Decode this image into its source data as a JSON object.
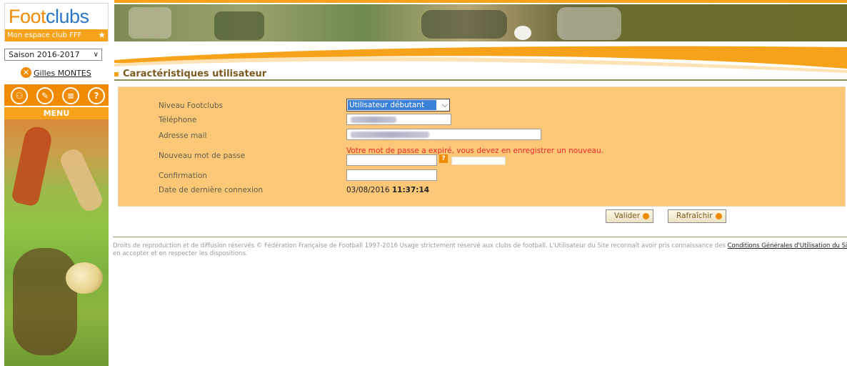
{
  "logo": {
    "part1": "Foot",
    "part2": "clubs",
    "tagline": "Mon espace club FFF"
  },
  "season_select": {
    "value": "Saison 2016-2017"
  },
  "user": {
    "name": "Gilles MONTES"
  },
  "menu": {
    "label": "MENU"
  },
  "section": {
    "title": "Caractéristiques utilisateur"
  },
  "form": {
    "level": {
      "label": "Niveau Footclubs",
      "value": "Utilisateur débutant"
    },
    "phone": {
      "label": "Téléphone"
    },
    "email": {
      "label": "Adresse mail"
    },
    "new_password": {
      "label": "Nouveau mot de passe",
      "error": "Votre mot de passe a expiré, vous devez en enregistrer un nouveau."
    },
    "confirm": {
      "label": "Confirmation"
    },
    "last_login": {
      "label": "Date de dernière connexion",
      "date": "03/08/2016",
      "time": "11:37:14"
    }
  },
  "buttons": {
    "validate": "Valider",
    "refresh": "Rafraîchir"
  },
  "footer": {
    "text_line1": "Droits de reproduction et de diffusion réservés © Fédération Française de Football 1997-2016 Usage strictement réservé aux clubs de football. L'Utilisateur du Site reconnaît avoir pris connaissance des",
    "link": "Conditions Générales d'Utilisation du Site",
    "text_line2": "en accepter et en respecter les dispositions."
  },
  "colors": {
    "orange": "#f08a00",
    "form_bg": "#fcc878",
    "error": "#e8282a",
    "select_highlight": "#3a80d6"
  }
}
